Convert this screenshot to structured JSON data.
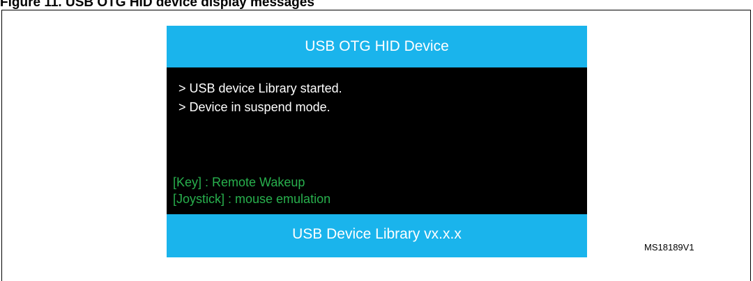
{
  "figure": {
    "caption": "Figure 11. USB OTG HID device display messages",
    "reference": "MS18189V1"
  },
  "screen": {
    "header_title": "USB OTG HID Device",
    "log": [
      "> USB device Library started.",
      "> Device in suspend mode."
    ],
    "hints": [
      "[Key] : Remote Wakeup",
      "[Joystick] : mouse emulation"
    ],
    "footer_text": "USB Device Library vx.x.x"
  },
  "colors": {
    "banner": "#1ab4ec",
    "console_bg": "#000000",
    "log_text": "#ffffff",
    "hint_text": "#28b04d"
  }
}
